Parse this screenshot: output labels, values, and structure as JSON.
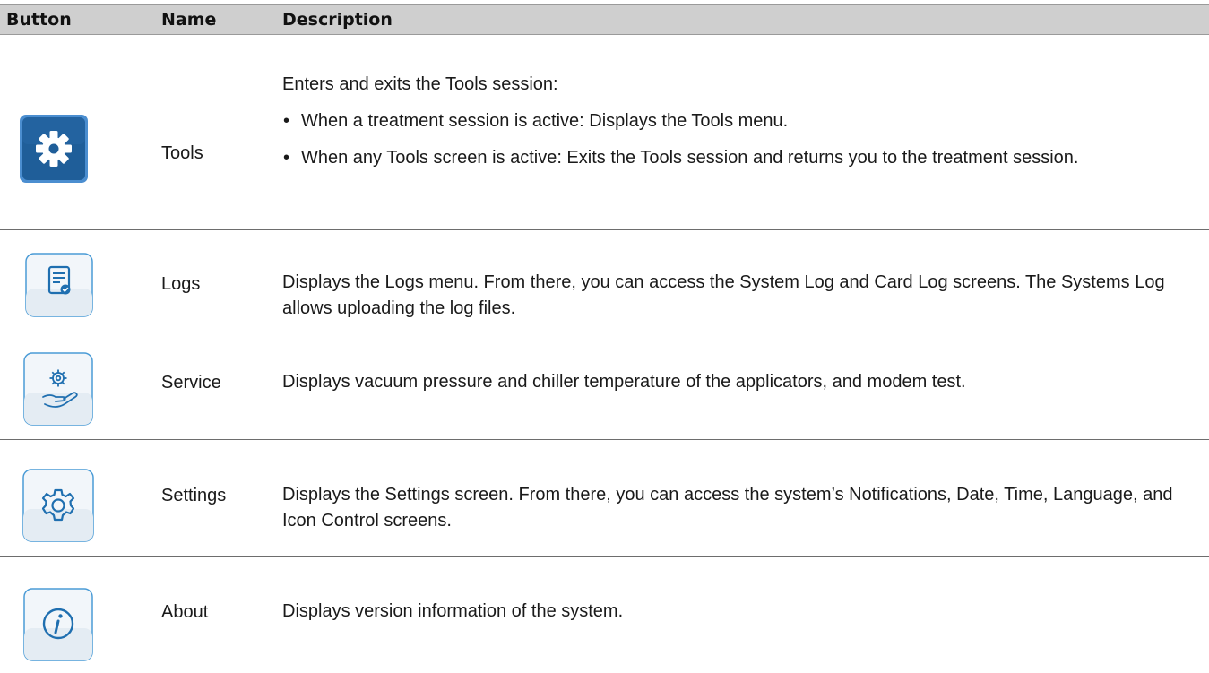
{
  "header": {
    "button": "Button",
    "name": "Name",
    "description": "Description"
  },
  "rows": [
    {
      "name": "Tools",
      "icon": "gear-icon",
      "intro": "Enters and exits the Tools session:",
      "bullets": [
        "When a treatment session is active: Displays the Tools menu.",
        "When any Tools screen is active: Exits the Tools session and returns you to the treatment session."
      ]
    },
    {
      "name": "Logs",
      "icon": "log-document-icon",
      "description": "Displays the Logs menu. From there, you can access the System Log and Card Log screens. The Systems Log allows uploading the log files."
    },
    {
      "name": "Service",
      "icon": "service-hand-gear-icon",
      "description": "Displays vacuum pressure and chiller temperature of the applicators, and modem test."
    },
    {
      "name": "Settings",
      "icon": "settings-gear-icon",
      "description": "Displays the Settings screen. From there, you can access the system’s Notifications, Date, Time, Language, and Icon Control screens."
    },
    {
      "name": "About",
      "icon": "info-icon",
      "description": "Displays version information of the system."
    }
  ],
  "colors": {
    "header_bg": "#cfcfcf",
    "tools_icon_bg": "#1f5e99",
    "light_icon_border": "#4a9bd6"
  }
}
